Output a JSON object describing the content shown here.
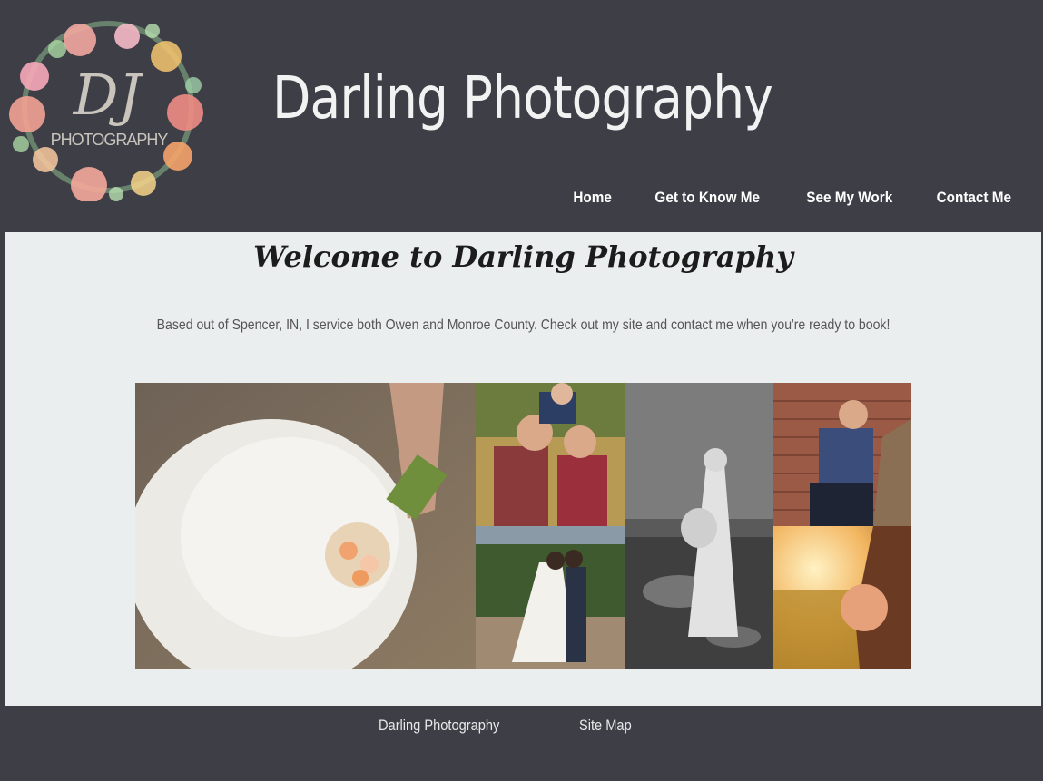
{
  "header": {
    "logo_text": "PHOTOGRAPHY",
    "logo_monogram": "DJ",
    "title": "Darling Photography"
  },
  "nav": {
    "items": [
      {
        "label": "Home"
      },
      {
        "label": "Get to Know Me"
      },
      {
        "label": "See My Work"
      },
      {
        "label": "Contact Me"
      }
    ]
  },
  "main": {
    "welcome": "Welcome to Darling Photography",
    "intro": "Based out of Spencer, IN, I service both Owen and Monroe County. Check out my site and contact me when you're ready to book!",
    "gallery": [
      {
        "subject": "bride bouquet on wedding dress"
      },
      {
        "subject": "family kissing outdoors"
      },
      {
        "subject": "wedding couple kissing"
      },
      {
        "subject": "maternity portrait in creek black and white"
      },
      {
        "subject": "young man seated by brick wall"
      },
      {
        "subject": "maternity silhouette at sunset"
      }
    ]
  },
  "footer": {
    "links": [
      {
        "label": "Darling Photography"
      },
      {
        "label": "Site Map"
      }
    ]
  },
  "colors": {
    "background": "#3e3e47",
    "content_bg": "#ebeeef",
    "text_dark": "#1c1c1c",
    "text_muted": "#555555"
  }
}
